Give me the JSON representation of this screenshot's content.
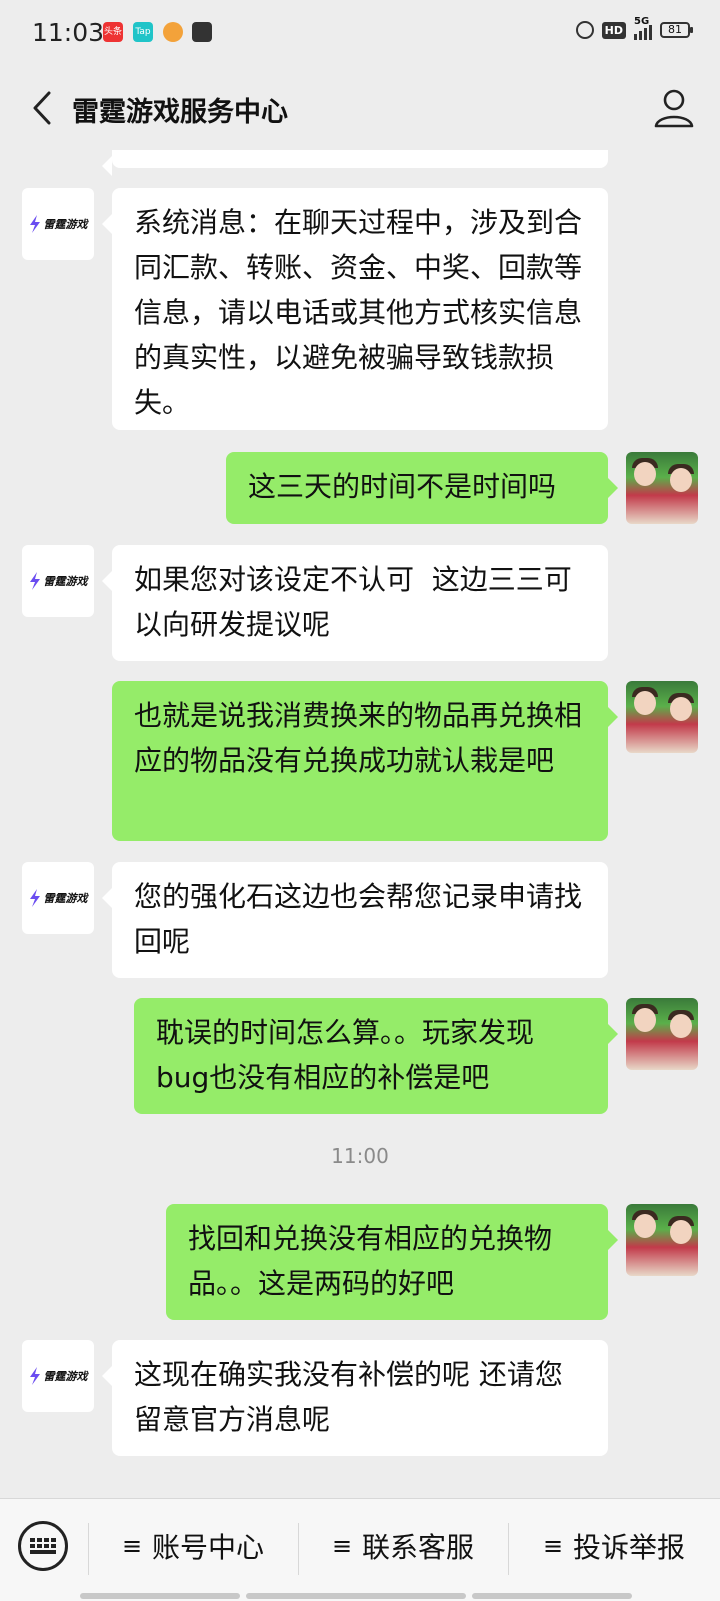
{
  "status_bar": {
    "time": "11:03",
    "app_icons": [
      "toutiao-icon",
      "taptap-icon",
      "dog-icon",
      "message-icon"
    ],
    "network": "5G",
    "battery": "81"
  },
  "header": {
    "back_icon": "chevron-left-icon",
    "title": "雷霆游戏服务中心",
    "profile_icon": "user-profile-icon"
  },
  "bot": {
    "logo_text": "雷霆游戏"
  },
  "messages": [
    {
      "side": "left",
      "text": "系统消息：在聊天过程中，涉及到合同汇款、转账、资金、中奖、回款等信息，请以电话或其他方式核实信息的真实性，以避免被骗导致钱款损失。"
    },
    {
      "side": "right",
      "text": "这三天的时间不是时间吗"
    },
    {
      "side": "left",
      "text": "如果您对该设定不认可  这边三三可以向研发提议呢"
    },
    {
      "side": "right",
      "text": "也就是说我消费换来的物品再兑换相应的物品没有兑换成功就认栽是吧"
    },
    {
      "side": "left",
      "text": "您的强化石这边也会帮您记录申请找回呢"
    },
    {
      "side": "right",
      "text": "耽误的时间怎么算。。玩家发现bug也没有相应的补偿是吧"
    },
    {
      "side": "right",
      "text": "找回和兑换没有相应的兑换物品。。这是两码的好吧"
    },
    {
      "side": "left",
      "text": "这现在确实我没有补偿的呢 还请您留意官方消息呢"
    }
  ],
  "time_divider": "11:00",
  "bottom_menu": {
    "keyboard_icon": "keyboard-icon",
    "items": [
      "账号中心",
      "联系客服",
      "投诉举报"
    ],
    "menu_glyph": "≡"
  },
  "colors": {
    "background": "#ededed",
    "bubble_self": "#95ec69",
    "bubble_other": "#ffffff"
  }
}
